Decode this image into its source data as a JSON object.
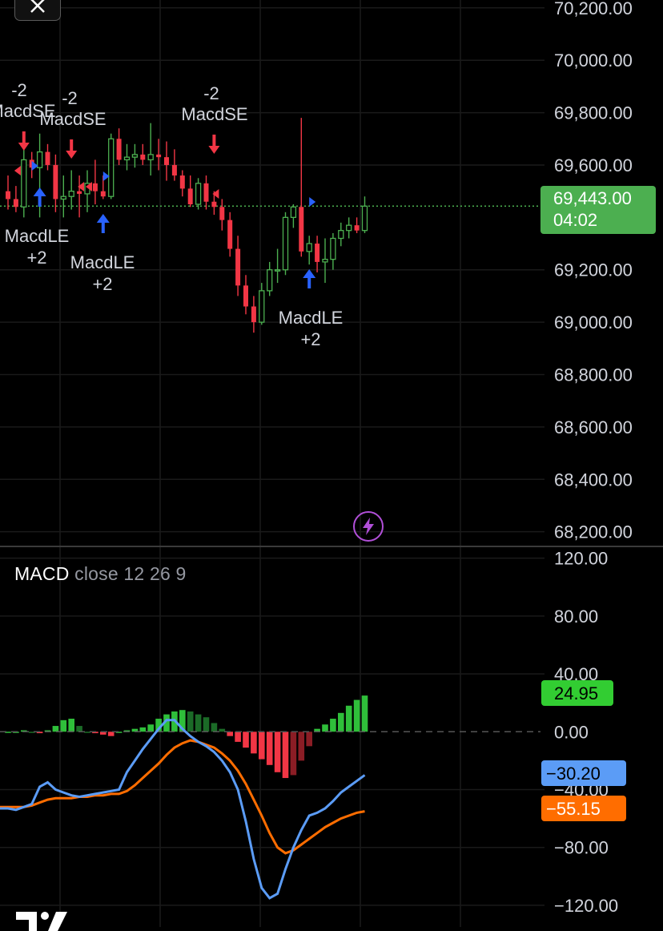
{
  "price_axis": {
    "ticks": [
      "70,200.00",
      "70,000.00",
      "69,800.00",
      "69,600.00",
      "69,200.00",
      "69,000.00",
      "68,800.00",
      "68,600.00",
      "68,400.00",
      "68,200.00"
    ],
    "current_price": "69,443.00",
    "countdown": "04:02",
    "current_color": "#4caf50"
  },
  "macd_axis": {
    "ticks": [
      "120.00",
      "80.00",
      "40.00",
      "0.00",
      "−40.00",
      "−80.00",
      "−120.00"
    ],
    "histogram_value": "24.95",
    "macd_value": "−30.20",
    "signal_value": "−55.15"
  },
  "macd_legend": {
    "name": "MACD",
    "params": "close  12  26  9"
  },
  "colors": {
    "up": "#4caf50",
    "down": "#f23645",
    "macd_line": "#5b9cf6",
    "signal_line": "#ff6d00",
    "hist_up_strong": "#26a69a",
    "hist_green": "#2fbf3a",
    "hist_green_dark": "#1b6b27",
    "hist_red": "#f23645",
    "hist_red_dark": "#8b1d25",
    "long_arrow": "#2962ff",
    "short_arrow": "#f23645",
    "badge_green": "#32cd32",
    "badge_blue": "#5b9cf6",
    "badge_orange": "#ff6d00"
  },
  "chart_data": [
    {
      "type": "candlestick",
      "ylim": [
        68150,
        70230
      ],
      "candles": [
        [
          69500,
          69560,
          69430,
          69470
        ],
        [
          69470,
          69520,
          69420,
          69440
        ],
        [
          69440,
          69700,
          69400,
          69620
        ],
        [
          69620,
          69650,
          69550,
          69590
        ],
        [
          69590,
          69720,
          69400,
          69650
        ],
        [
          69650,
          69680,
          69580,
          69600
        ],
        [
          69600,
          69640,
          69420,
          69470
        ],
        [
          69470,
          69560,
          69400,
          69480
        ],
        [
          69480,
          69580,
          69430,
          69500
        ],
        [
          69500,
          69560,
          69400,
          69490
        ],
        [
          69490,
          69580,
          69420,
          69530
        ],
        [
          69530,
          69620,
          69450,
          69500
        ],
        [
          69500,
          69560,
          69470,
          69480
        ],
        [
          69480,
          69720,
          69470,
          69700
        ],
        [
          69700,
          69740,
          69600,
          69620
        ],
        [
          69620,
          69680,
          69580,
          69630
        ],
        [
          69630,
          69680,
          69590,
          69640
        ],
        [
          69640,
          69680,
          69600,
          69620
        ],
        [
          69620,
          69760,
          69560,
          69640
        ],
        [
          69640,
          69700,
          69580,
          69630
        ],
        [
          69630,
          69690,
          69540,
          69600
        ],
        [
          69600,
          69660,
          69540,
          69560
        ],
        [
          69560,
          69580,
          69480,
          69510
        ],
        [
          69510,
          69560,
          69440,
          69450
        ],
        [
          69450,
          69550,
          69430,
          69530
        ],
        [
          69530,
          69560,
          69430,
          69460
        ],
        [
          69460,
          69500,
          69410,
          69440
        ],
        [
          69440,
          69470,
          69350,
          69390
        ],
        [
          69390,
          69420,
          69250,
          69280
        ],
        [
          69280,
          69330,
          69100,
          69140
        ],
        [
          69140,
          69180,
          69030,
          69060
        ],
        [
          69060,
          69100,
          68960,
          69000
        ],
        [
          69000,
          69150,
          68990,
          69120
        ],
        [
          69120,
          69230,
          69100,
          69200
        ],
        [
          69200,
          69280,
          69150,
          69200
        ],
        [
          69200,
          69420,
          69180,
          69400
        ],
        [
          69400,
          69450,
          69360,
          69440
        ],
        [
          69440,
          69780,
          69250,
          69270
        ],
        [
          69270,
          69330,
          69220,
          69300
        ],
        [
          69300,
          69330,
          69190,
          69230
        ],
        [
          69230,
          69320,
          69150,
          69240
        ],
        [
          69240,
          69340,
          69200,
          69320
        ],
        [
          69320,
          69380,
          69290,
          69350
        ],
        [
          69350,
          69400,
          69320,
          69370
        ],
        [
          69370,
          69400,
          69340,
          69350
        ],
        [
          69350,
          69480,
          69340,
          69443
        ]
      ],
      "signals": [
        {
          "label": "MacdSE",
          "qty": "-2"
        },
        {
          "label": "MacdSE",
          "qty": "-2"
        },
        {
          "label": "MacdSE",
          "qty": "-2"
        },
        {
          "label": "MacdLE",
          "qty": "+2"
        },
        {
          "label": "MacdLE",
          "qty": "+2"
        },
        {
          "label": "MacdLE",
          "qty": "+2"
        }
      ]
    },
    {
      "type": "bar",
      "name": "MACD histogram",
      "ylim": [
        -135,
        127
      ],
      "values": [
        0,
        0,
        1,
        0,
        -1,
        1,
        4,
        8,
        9,
        4,
        0,
        -1,
        -2,
        -3,
        0,
        1,
        2,
        3,
        5,
        9,
        12,
        14,
        15,
        14,
        12,
        10,
        6,
        2,
        -3,
        -7,
        -11,
        -15,
        -19,
        -23,
        -28,
        -32,
        -30,
        -20,
        -10,
        2,
        5,
        9,
        13,
        18,
        22,
        25
      ]
    },
    {
      "type": "line",
      "ylim": [
        -135,
        127
      ],
      "series": [
        {
          "values": [
            -53,
            -54,
            -52,
            -50,
            -38,
            -35,
            -40,
            -42,
            -44,
            -45,
            -44,
            -43,
            -42,
            -41,
            -40,
            -28,
            -20,
            -12,
            -5,
            2,
            8,
            8,
            2,
            -3,
            -7,
            -10,
            -14,
            -20,
            -28,
            -40,
            -62,
            -88,
            -108,
            -115,
            -112,
            -95,
            -80,
            -68,
            -58,
            -56,
            -53,
            -48,
            -42,
            -38,
            -34,
            -30
          ]
        },
        {
          "values": [
            -52,
            -52,
            -52,
            -51,
            -49,
            -47,
            -46,
            -46,
            -46,
            -45,
            -45,
            -44,
            -44,
            -43,
            -43,
            -41,
            -37,
            -32,
            -27,
            -22,
            -16,
            -11,
            -8,
            -6,
            -7,
            -9,
            -11,
            -15,
            -20,
            -27,
            -36,
            -47,
            -58,
            -70,
            -80,
            -84,
            -82,
            -78,
            -74,
            -70,
            -66,
            -63,
            -60,
            -58,
            -56,
            -55
          ]
        }
      ]
    }
  ]
}
